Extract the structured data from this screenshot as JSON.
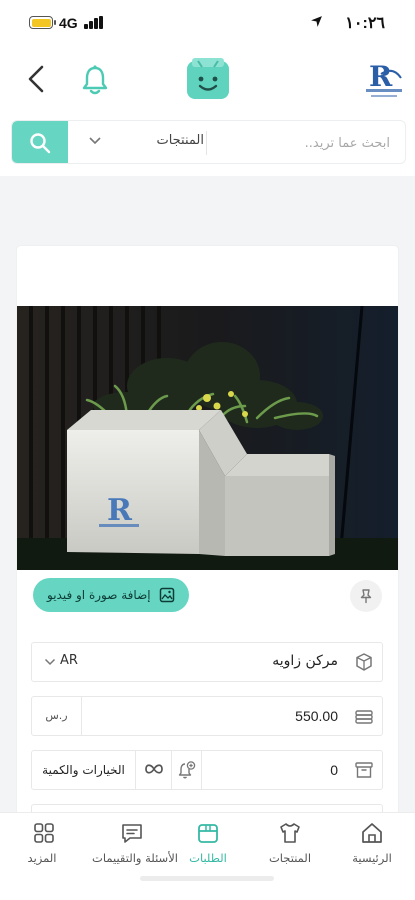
{
  "status_bar": {
    "time": "١٠:٢٦",
    "network": "4G",
    "icons": [
      "battery-icon",
      "signal-icon",
      "location-arrow-icon"
    ],
    "battery_color": "#f3c623"
  },
  "header": {
    "icons": [
      "back-chevron-icon",
      "bell-icon",
      "mascot-logo",
      "brand-logo"
    ],
    "accent_color": "#66d6c2"
  },
  "search": {
    "placeholder": "ابحث عما تريد..",
    "category": "المنتجات",
    "button_icon": "search-icon"
  },
  "product_form": {
    "add_media_label": "إضافة صورة او فيديو",
    "name": "مركن زاويه",
    "language": "AR",
    "price": "550.00",
    "currency": "ر.س",
    "quantity": "0",
    "options_label": "الخيارات والكمية"
  },
  "tabbar": {
    "active_tab": "orders",
    "tabs": [
      {
        "key": "home",
        "label": "الرئيسية",
        "icon": "home-icon"
      },
      {
        "key": "products",
        "label": "المنتجات",
        "icon": "tshirt-icon"
      },
      {
        "key": "orders",
        "label": "الطلبات",
        "icon": "orders-box-icon"
      },
      {
        "key": "qa",
        "label": "الأسئلة والتقييمات",
        "icon": "chat-icon"
      },
      {
        "key": "more",
        "label": "المزيد",
        "icon": "grid-icon"
      }
    ],
    "active_color": "#35b9a4"
  }
}
